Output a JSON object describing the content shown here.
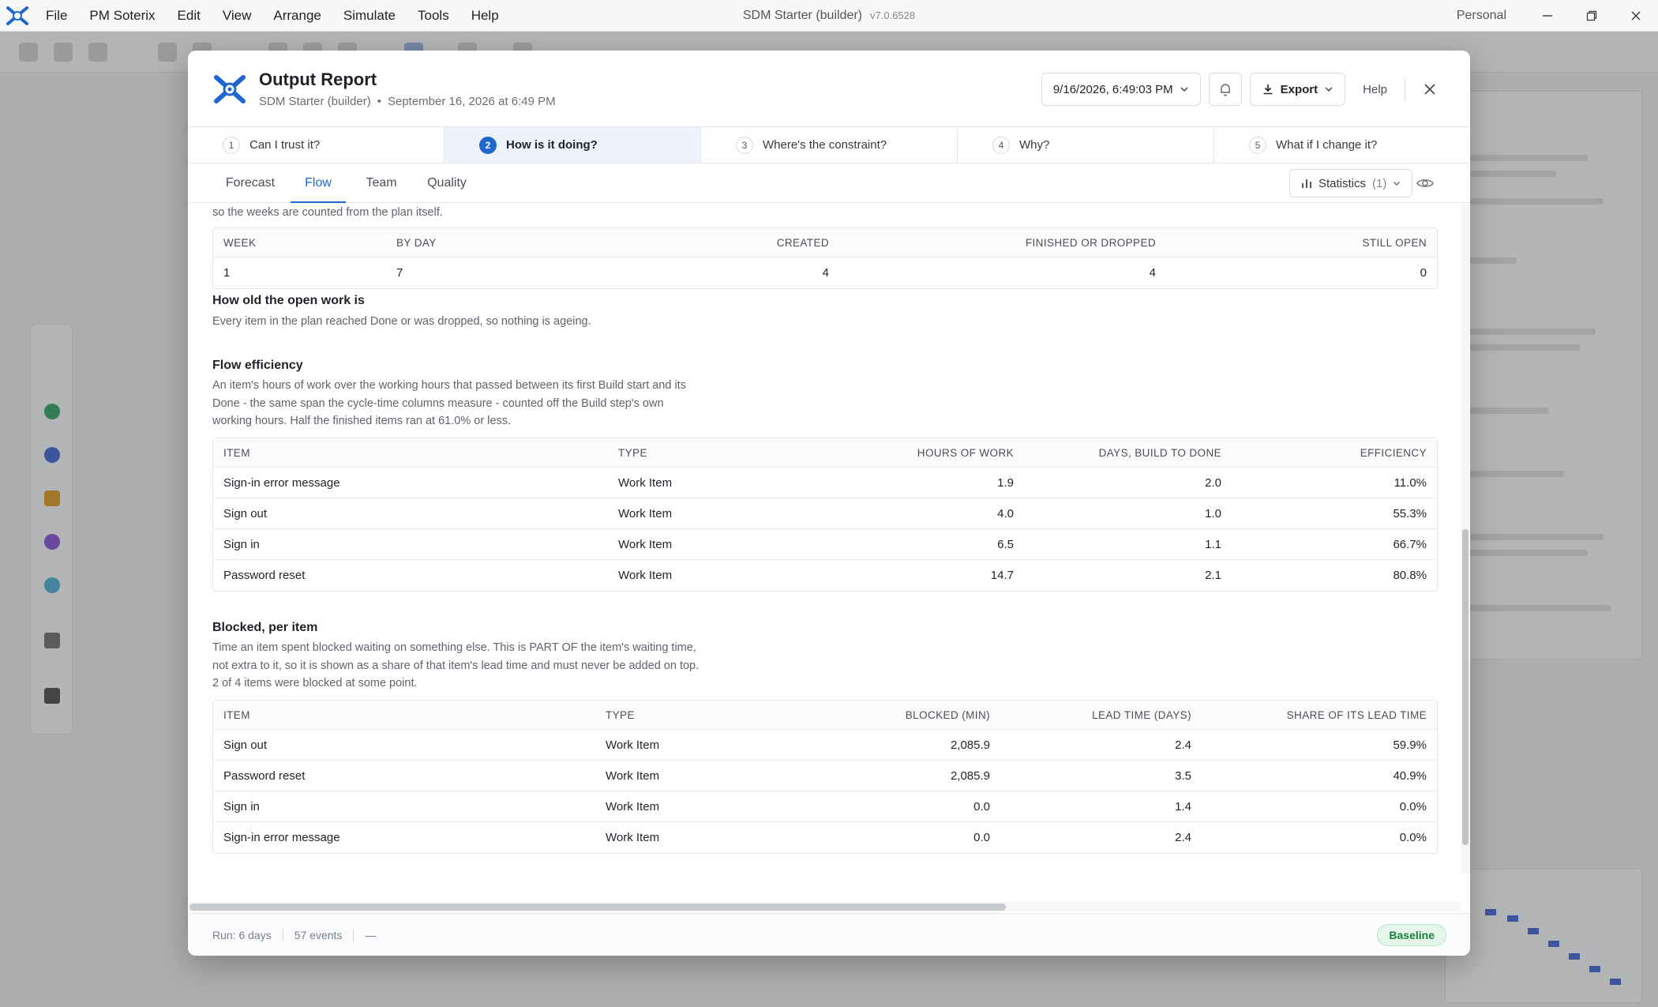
{
  "menubar": {
    "items": [
      "File",
      "PM Soterix",
      "Edit",
      "View",
      "Arrange",
      "Simulate",
      "Tools",
      "Help"
    ],
    "window_title": "SDM Starter (builder)",
    "version": "v7.0.6528",
    "account": "Personal"
  },
  "modal": {
    "title": "Output Report",
    "project": "SDM Starter (builder)",
    "separator": "•",
    "generated": "September 16, 2026 at 6:49 PM",
    "run_select": "9/16/2026, 6:49:03 PM",
    "export_label": "Export",
    "help_label": "Help"
  },
  "steps": [
    {
      "num": "1",
      "label": "Can I trust it?"
    },
    {
      "num": "2",
      "label": "How is it doing?"
    },
    {
      "num": "3",
      "label": "Where's the constraint?"
    },
    {
      "num": "4",
      "label": "Why?"
    },
    {
      "num": "5",
      "label": "What if I change it?"
    }
  ],
  "subtabs": [
    "Forecast",
    "Flow",
    "Team",
    "Quality"
  ],
  "statistics": {
    "label": "Statistics",
    "count": "(1)"
  },
  "weekly": {
    "intro_tail": "so the weeks are counted from the plan itself.",
    "headers": [
      "WEEK",
      "BY DAY",
      "CREATED",
      "FINISHED OR DROPPED",
      "STILL OPEN"
    ],
    "rows": [
      [
        "1",
        "7",
        "4",
        "4",
        "0"
      ]
    ]
  },
  "ageing": {
    "title": "How old the open work is",
    "desc": "Every item in the plan reached Done or was dropped, so nothing is ageing."
  },
  "flow_efficiency": {
    "title": "Flow efficiency",
    "desc": [
      "An item's hours of work over the working hours that passed between its first Build start and its",
      "Done - the same span the cycle-time columns measure - counted off the Build step's own",
      "working hours. Half the finished items ran at 61.0% or less."
    ],
    "headers": [
      "ITEM",
      "TYPE",
      "HOURS OF WORK",
      "DAYS, BUILD TO DONE",
      "EFFICIENCY"
    ],
    "rows": [
      [
        "Sign-in error message",
        "Work Item",
        "1.9",
        "2.0",
        "11.0%"
      ],
      [
        "Sign out",
        "Work Item",
        "4.0",
        "1.0",
        "55.3%"
      ],
      [
        "Sign in",
        "Work Item",
        "6.5",
        "1.1",
        "66.7%"
      ],
      [
        "Password reset",
        "Work Item",
        "14.7",
        "2.1",
        "80.8%"
      ]
    ]
  },
  "blocked": {
    "title": "Blocked, per item",
    "desc": [
      "Time an item spent blocked waiting on something else. This is PART OF the item's waiting time,",
      "not extra to it, so it is shown as a share of that item's lead time and must never be added on top.",
      "2 of 4 items were blocked at some point."
    ],
    "headers": [
      "ITEM",
      "TYPE",
      "BLOCKED (MIN)",
      "LEAD TIME (DAYS)",
      "SHARE OF ITS LEAD TIME"
    ],
    "rows": [
      [
        "Sign out",
        "Work Item",
        "2,085.9",
        "2.4",
        "59.9%"
      ],
      [
        "Password reset",
        "Work Item",
        "2,085.9",
        "3.5",
        "40.9%"
      ],
      [
        "Sign in",
        "Work Item",
        "0.0",
        "1.4",
        "0.0%"
      ],
      [
        "Sign-in error message",
        "Work Item",
        "0.0",
        "2.4",
        "0.0%"
      ]
    ]
  },
  "footer": {
    "run": "Run: 6 days",
    "events": "57 events",
    "dash": "—",
    "badge": "Baseline"
  },
  "colors": {
    "accent": "#1f66d1",
    "baseline_green": "#1a7f3c"
  },
  "icons": [
    "app-logo-icon",
    "minimize-icon",
    "maximize-icon",
    "close-icon",
    "chevron-down-icon",
    "bell-icon",
    "download-icon",
    "bar-chart-icon",
    "eye-icon"
  ]
}
